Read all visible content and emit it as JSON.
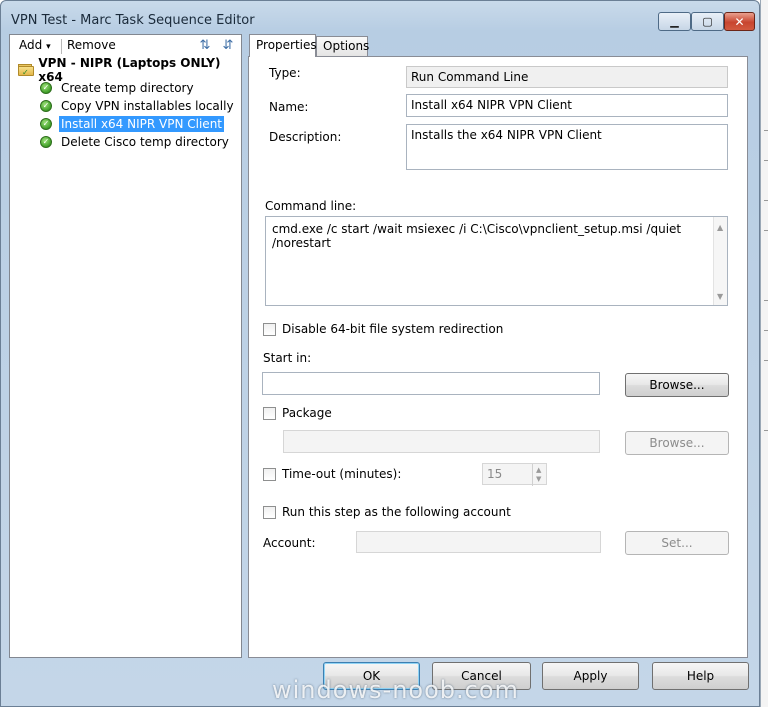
{
  "window": {
    "title": "VPN Test - Marc Task Sequence Editor",
    "controls": {
      "minimize": "▁",
      "maximize": "▢",
      "close": "✕"
    }
  },
  "toolbar": {
    "add_label": "Add",
    "add_arrow": "▾",
    "remove_label": "Remove",
    "icon_move_up": "move-up-icon",
    "icon_move_down": "move-down-icon"
  },
  "tree": {
    "root_label": "VPN - NIPR (Laptops ONLY) x64",
    "items": [
      {
        "label": "Create temp directory",
        "selected": false
      },
      {
        "label": "Copy VPN installables locally",
        "selected": false
      },
      {
        "label": "Install x64 NIPR VPN Client",
        "selected": true
      },
      {
        "label": "Delete Cisco temp directory",
        "selected": false
      }
    ]
  },
  "tabs": [
    {
      "label": "Properties",
      "active": true
    },
    {
      "label": "Options",
      "active": false
    }
  ],
  "properties": {
    "type_label": "Type:",
    "type_value": "Run Command Line",
    "name_label": "Name:",
    "name_value": "Install x64 NIPR VPN Client",
    "description_label": "Description:",
    "description_value": "Installs the x64 NIPR VPN Client",
    "command_line_label": "Command line:",
    "command_line_value": "cmd.exe /c start /wait msiexec /i C:\\Cisco\\vpnclient_setup.msi /quiet /norestart",
    "disable_redirection_label": "Disable 64-bit file system redirection",
    "start_in_label": "Start in:",
    "start_in_value": "",
    "browse_label": "Browse...",
    "package_label": "Package",
    "package_browse_label": "Browse...",
    "timeout_label": "Time-out (minutes):",
    "timeout_value": "15",
    "run_as_label": "Run this step as the following account",
    "account_label": "Account:",
    "account_value": "",
    "set_label": "Set..."
  },
  "buttons": {
    "ok": "OK",
    "cancel": "Cancel",
    "apply": "Apply",
    "help": "Help"
  },
  "watermark": "windows-noob.com"
}
